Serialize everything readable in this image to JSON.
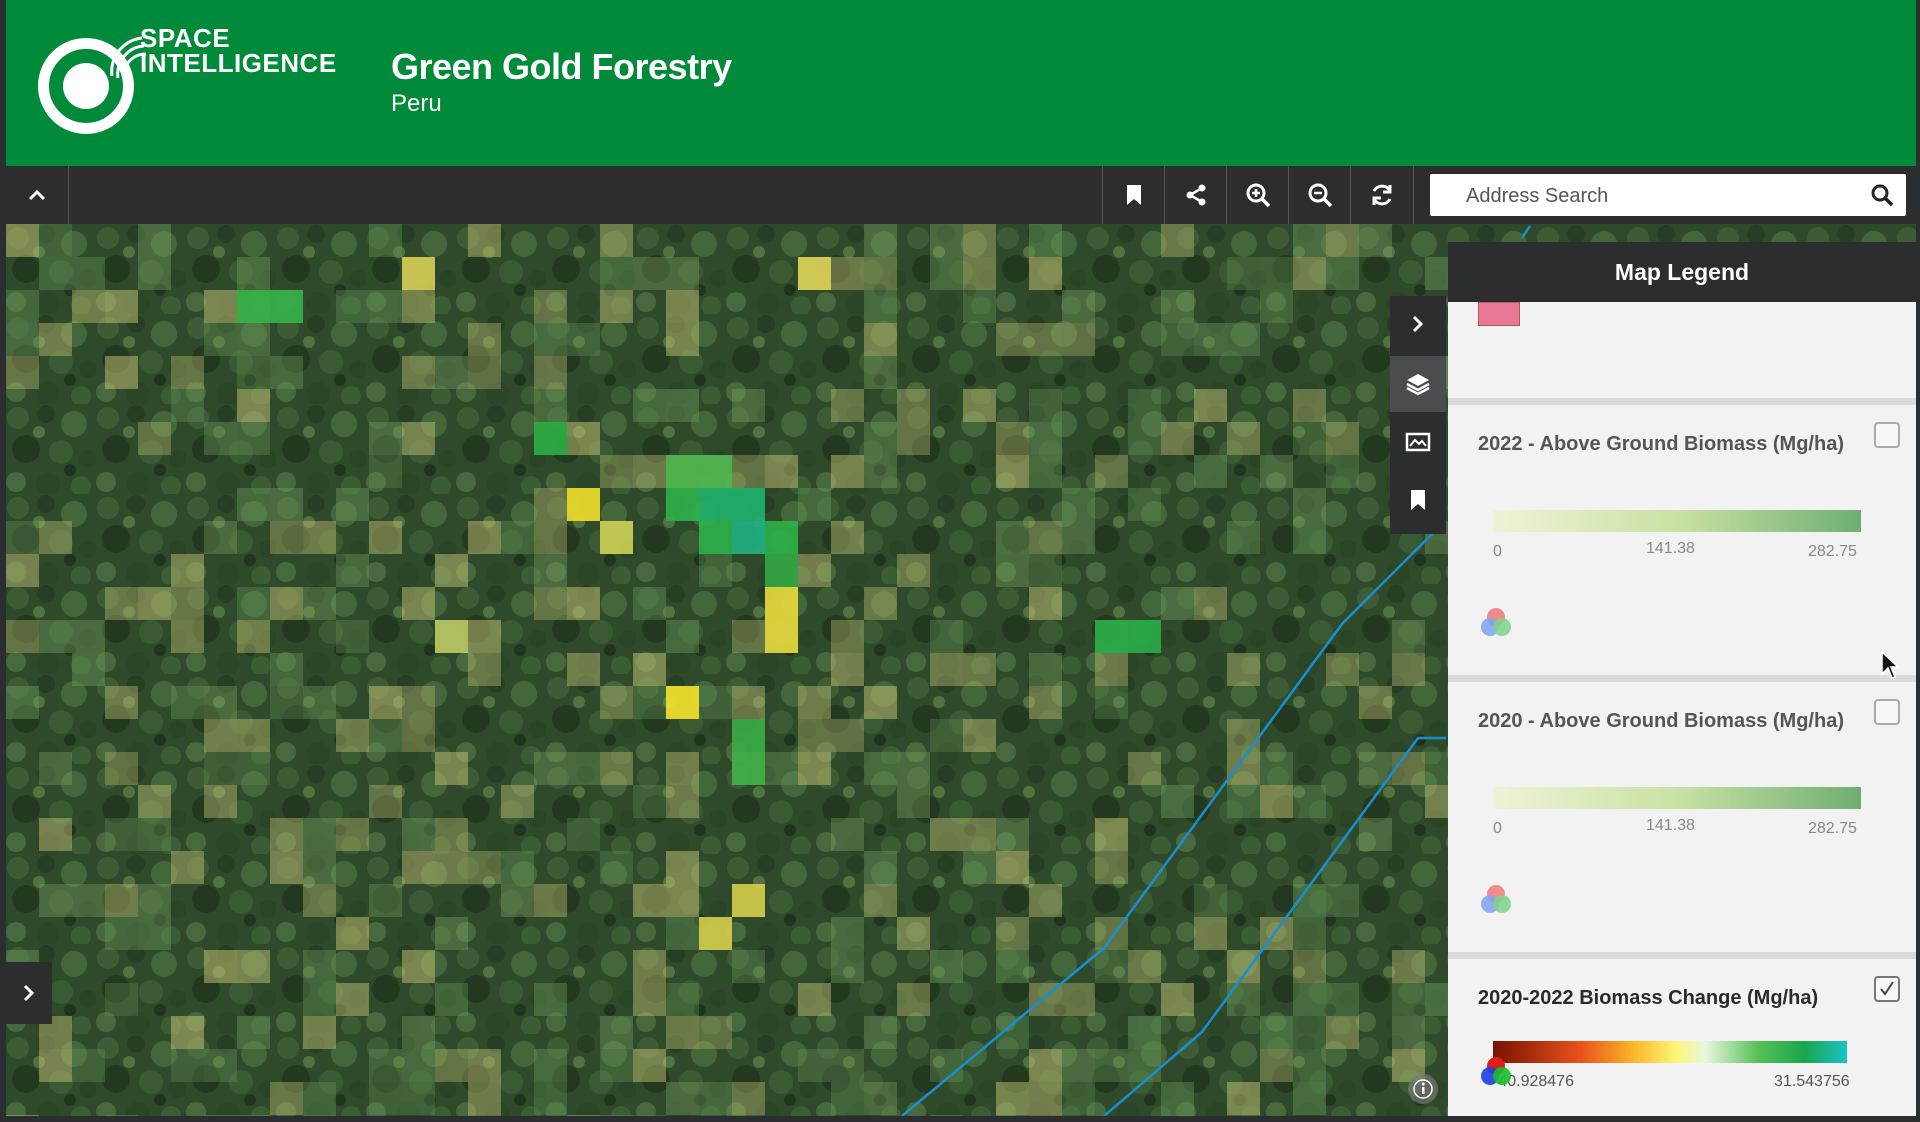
{
  "brand": {
    "logo_line1": "SPACE",
    "logo_line2": "INTELLIGENCE",
    "title": "Green Gold Forestry",
    "subtitle": "Peru"
  },
  "toolbar": {
    "collapse_icon": "chevron-up-icon",
    "buttons": [
      {
        "name": "bookmark-button",
        "icon": "bookmark-icon"
      },
      {
        "name": "share-button",
        "icon": "share-icon"
      },
      {
        "name": "zoom-in-button",
        "icon": "zoom-in-icon"
      },
      {
        "name": "zoom-out-button",
        "icon": "zoom-out-icon"
      },
      {
        "name": "refresh-button",
        "icon": "refresh-icon"
      }
    ],
    "search_placeholder": "Address Search"
  },
  "map_rail": {
    "items": [
      "chevron-right-icon",
      "layers-icon",
      "basemap-icon",
      "bookmark-icon"
    ],
    "active": "layers-icon"
  },
  "legend": {
    "title": "Map Legend",
    "cards": [
      {
        "title": "2022 - Above Ground Biomass (Mg/ha)",
        "checked": false,
        "min": "0",
        "mid": "141.38",
        "max": "282.75",
        "ramp_colors": [
          "#eef3d6",
          "#c9e2a4",
          "#6fae72"
        ]
      },
      {
        "title": "2020 - Above Ground Biomass (Mg/ha)",
        "checked": false,
        "min": "0",
        "mid": "141.38",
        "max": "282.75",
        "ramp_colors": [
          "#eef3d6",
          "#c9e2a4",
          "#6fae72"
        ]
      },
      {
        "title": "2020-2022 Biomass Change (Mg/ha)",
        "checked": true,
        "min": "-40.928476",
        "max": "31.543756",
        "ramp_colors": [
          "#7a1100",
          "#e9541b",
          "#fbb82a",
          "#fdf77a",
          "#e8f6e0",
          "#56c056",
          "#1aa64c",
          "#19c2c8"
        ]
      }
    ]
  },
  "colors": {
    "header_green": "#008a39",
    "toolbar_dark": "#2c2d2f",
    "road_blue": "#1a8fd0"
  }
}
